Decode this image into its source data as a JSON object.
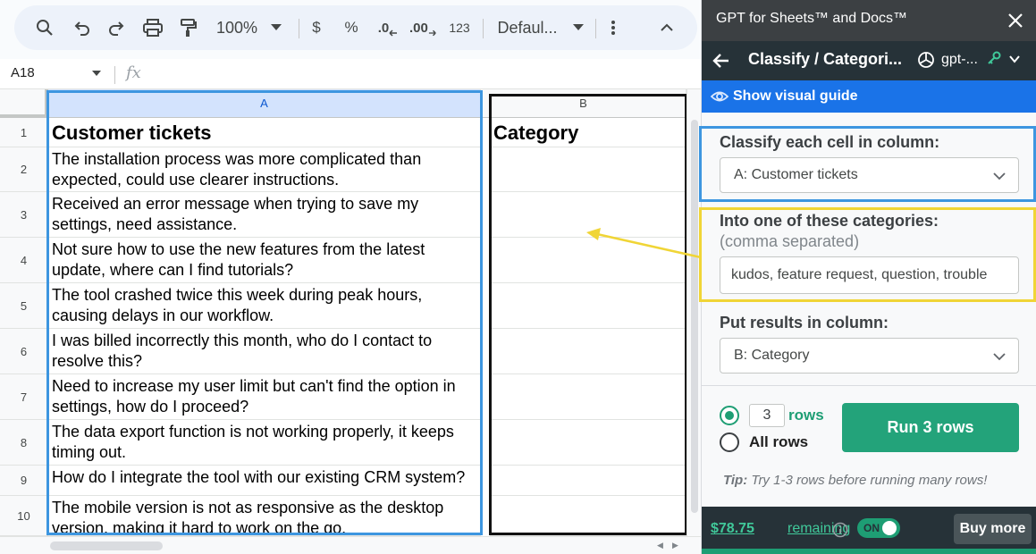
{
  "toolbar": {
    "zoom": "100%",
    "currency": "$",
    "percent": "%",
    "decimal_decrease": ".0",
    "decimal_increase": ".00",
    "number_format": "123",
    "font": "Defaul..."
  },
  "formula_bar": {
    "cell_ref": "A18",
    "fx": "fx"
  },
  "grid": {
    "columns": [
      "A",
      "B"
    ],
    "row_numbers": [
      "1",
      "2",
      "3",
      "4",
      "5",
      "6",
      "7",
      "8",
      "9",
      "10"
    ],
    "col_a": [
      "Customer tickets",
      "The installation process was more complicated than expected, could use clearer instructions.",
      "Received an error message when trying to save my settings, need assistance.",
      "Not sure how to use the new features from the latest update, where can I find tutorials?",
      "The tool crashed twice this week during peak hours, causing delays in our workflow.",
      "I was billed incorrectly this month, who do I contact to resolve this?",
      "Need to increase my user limit but can't find the option in settings, how do I proceed?",
      "The data export function is not working properly, it keeps timing out.",
      "How do I integrate the tool with our existing CRM system?",
      "The mobile version is not as responsive as the desktop version, making it hard to work on the go."
    ],
    "col_b": [
      "Category",
      "",
      "",
      "",
      "",
      "",
      "",
      "",
      "",
      ""
    ]
  },
  "sidebar": {
    "title": "GPT for Sheets™ and Docs™",
    "tool_title": "Classify / Categori...",
    "model": "gpt-...",
    "guide_label": "Show visual guide",
    "classify_label": "Classify each cell in column:",
    "classify_value": "A: Customer tickets",
    "categories_label": "Into one of these categories:",
    "categories_sub": "(comma separated)",
    "categories_value": "kudos, feature request, question, trouble",
    "results_label": "Put results in column:",
    "results_value": "B: Category",
    "rows_count": "3",
    "rows_label": "rows",
    "all_rows_label": "All rows",
    "run_label": "Run 3 rows",
    "tip_prefix": "Tip:",
    "tip_text": "Try 1-3 rows before running many rows!",
    "balance": "$78.75",
    "balance_suffix": "remaining",
    "toggle_label": "ON",
    "buy_label": "Buy more"
  },
  "colors": {
    "selection_blue": "#3d96e0",
    "highlight_yellow": "#f0d536",
    "run_green": "#23a37a",
    "sidebar_dark": "#263238"
  }
}
